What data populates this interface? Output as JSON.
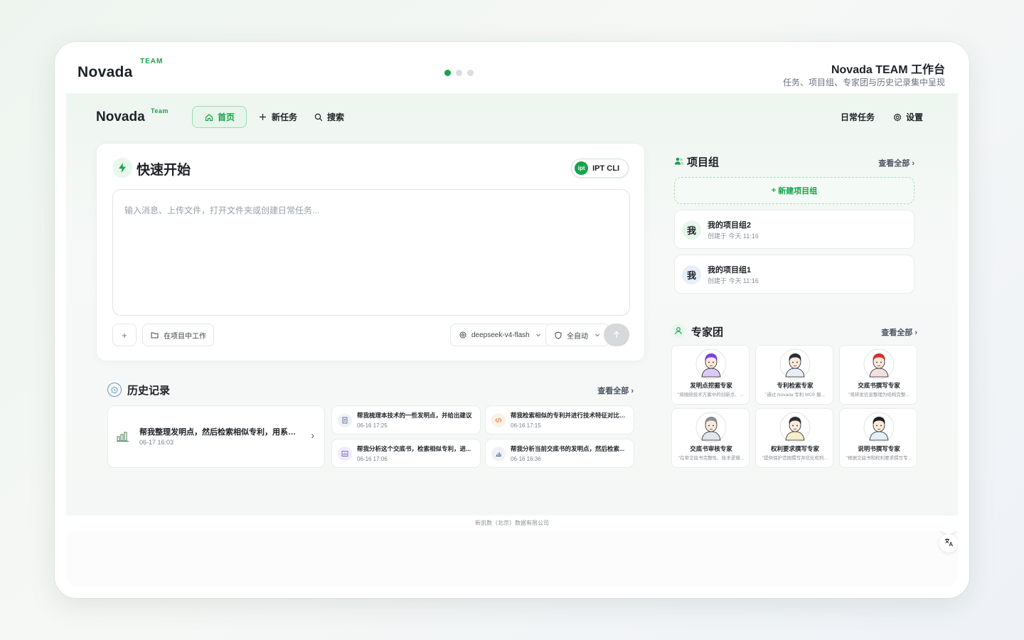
{
  "header": {
    "logo": "Novada",
    "logo_badge": "TEAM",
    "title": "Novada TEAM 工作台",
    "subtitle": "任务、项目组、专家团与历史记录集中呈现"
  },
  "nav": {
    "logo": "Novada",
    "logo_badge": "Team",
    "home": "首页",
    "new_task": "新任务",
    "search": "搜索",
    "daily_tasks": "日常任务",
    "settings": "设置"
  },
  "quick_start": {
    "title": "快速开始",
    "cli_label": "IPT CLI",
    "cli_logo": "ipt",
    "input_placeholder": "输入消息、上传文件，打开文件夹或创建日常任务...",
    "add": "+",
    "work_in_project": "在项目中工作",
    "model": "deepseek-v4-flash",
    "mode": "全自动"
  },
  "history": {
    "title": "历史记录",
    "see_all": "查看全部",
    "featured": {
      "title": "帮我整理发明点，然后检索相似专利，用系统...",
      "time": "06-17 16:03"
    },
    "items": [
      {
        "title": "帮我梳理本技术的一些发明点，并给出建议",
        "time": "06-16 17:25",
        "icon": "document-icon",
        "color": "#eef2f8"
      },
      {
        "title": "帮我检索相似的专利并进行技术特征对比分析",
        "time": "06-16 17:15",
        "icon": "code-icon",
        "color": "#fdf1e6"
      },
      {
        "title": "帮我分析这个交底书，检索相似专利，进...",
        "time": "06-16 17:06",
        "icon": "chart-icon",
        "color": "#f1ecfb"
      },
      {
        "title": "帮我分析当前交底书的发明点，然后检索...",
        "time": "06-16 16:36",
        "icon": "chart-icon",
        "color": "#eef2f8"
      }
    ]
  },
  "project_groups": {
    "title": "项目组",
    "see_all": "查看全部",
    "new_label": "新建项目组",
    "items": [
      {
        "avatar": "我",
        "name": "我的项目组2",
        "meta": "创建于 今天 11:16",
        "color": "#e6f6ea"
      },
      {
        "avatar": "我",
        "name": "我的项目组1",
        "meta": "创建于 今天 11:16",
        "color": "#e7effa"
      }
    ]
  },
  "experts": {
    "title": "专家团",
    "see_all": "查看全部",
    "items": [
      {
        "name": "发明点挖掘专家",
        "desc": "\"将围绕技术方案中的创新点、区...",
        "hair": "#7b3fe4",
        "shirt": "#d9c9f5"
      },
      {
        "name": "专利检索专家",
        "desc": "\"通过 Novada 专利 MCP 服...",
        "hair": "#2a2f36",
        "shirt": "#e7eef7"
      },
      {
        "name": "交底书撰写专家",
        "desc": "\"将研发信息整理为结构完整...",
        "hair": "#d92d2d",
        "shirt": "#f4dede"
      },
      {
        "name": "交底书审核专家",
        "desc": "\"在审交底书完整性、技术逻辑...",
        "hair": "#8a8d90",
        "shirt": "#e2e6ea"
      },
      {
        "name": "权利要求撰写专家",
        "desc": "\"提供保护范围撰写并优化权利...",
        "hair": "#2a2f36",
        "shirt": "#f6edc9"
      },
      {
        "name": "说明书撰写专家",
        "desc": "\"根据交底书和权利要求撰写专...",
        "hair": "#1d2127",
        "shirt": "#e7eef7"
      }
    ]
  },
  "footer": {
    "text": "新凯数（北京）数据有限公司"
  },
  "colors": {
    "accent": "#16a34a",
    "accent_light": "#e6f6ea"
  }
}
